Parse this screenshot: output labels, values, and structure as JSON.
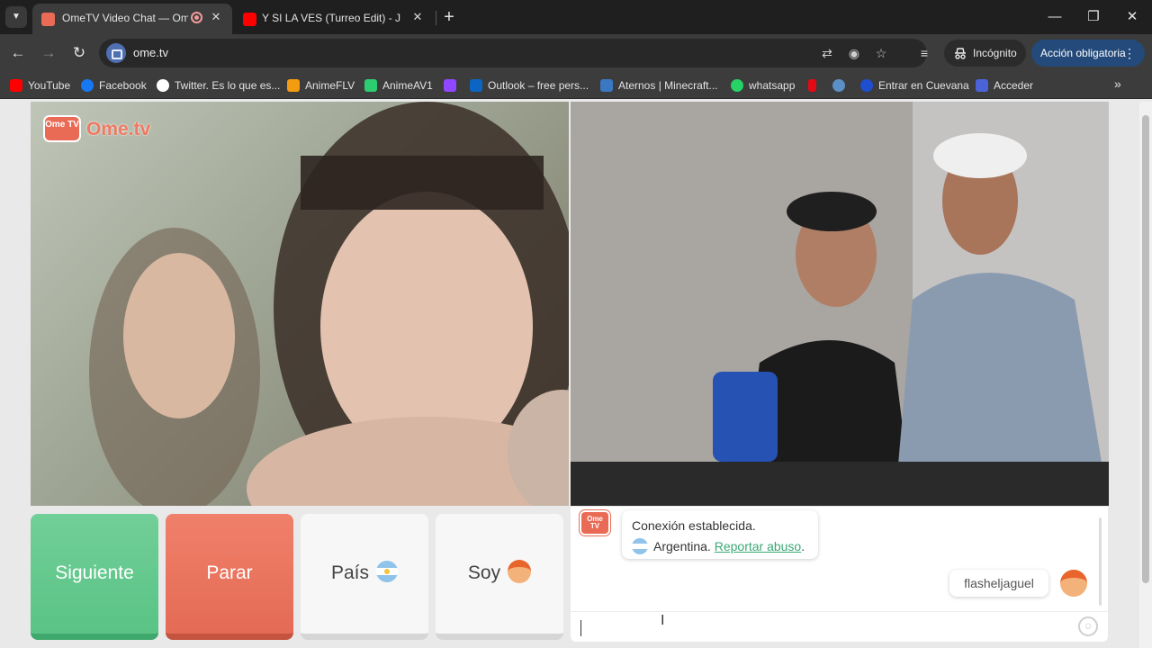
{
  "browser": {
    "tabs": [
      {
        "title": "OmeTV Video Chat — Ome",
        "favicon_color": "#e96b56",
        "active": true
      },
      {
        "title": "Y SI LA VES (Turreo Edit) - Jona",
        "favicon_color": "#ff0000",
        "active": false
      }
    ],
    "url": "ome.tv",
    "incognito_label": "Incógnito",
    "action_label": "Acción obligatoria",
    "bookmarks": [
      {
        "label": "YouTube",
        "color": "#ff0000"
      },
      {
        "label": "Facebook",
        "color": "#1877f2"
      },
      {
        "label": "Twitter. Es lo que es...",
        "color": "#ffffff"
      },
      {
        "label": "AnimeFLV",
        "color": "#f39c12"
      },
      {
        "label": "AnimeAV1",
        "color": "#2ecc71"
      },
      {
        "label": "",
        "color": "#9146ff"
      },
      {
        "label": "Outlook – free pers...",
        "color": "#0a66c2"
      },
      {
        "label": "Aternos | Minecraft...",
        "color": "#3b78c4"
      },
      {
        "label": "whatsapp",
        "color": "#25d366"
      },
      {
        "label": "",
        "color": "#e50914"
      },
      {
        "label": "",
        "color": "#5b8fc7"
      },
      {
        "label": "Entrar en Cuevana",
        "color": "#1e4fd1"
      },
      {
        "label": "Acceder",
        "color": "#4b63d8"
      }
    ]
  },
  "app": {
    "logo_box": "Ome TV",
    "logo_word": "Ome.tv",
    "buttons": {
      "next": "Siguiente",
      "stop": "Parar",
      "country": "País",
      "gender": "Soy"
    },
    "chat": {
      "system_line1": "Conexión establecida.",
      "country_name": "Argentina.",
      "report_link": "Reportar abuso",
      "report_suffix": ".",
      "user_message": "flasheljaguel"
    }
  },
  "colors": {
    "accent_green": "#5ac385",
    "accent_red": "#e46b55",
    "brand": "#e96b56"
  }
}
